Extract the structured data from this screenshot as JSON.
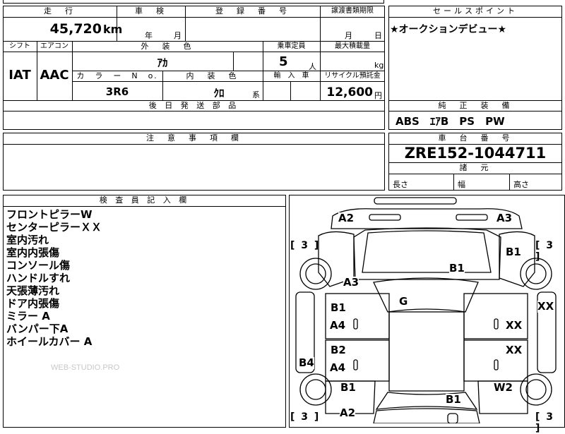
{
  "header_row": {
    "mileage": "走　行",
    "inspection": "車　検",
    "registration": "登　録　番　号",
    "transfer_deadline": "譲渡書類期限",
    "sales_point": "セールスポイント"
  },
  "values_row": {
    "mileage": "45,720",
    "mileage_unit": "km",
    "inspection_year": "年",
    "inspection_month": "月",
    "transfer_month": "月",
    "transfer_day": "日",
    "sales_point": "★オークションデビュー★"
  },
  "labels_row2": {
    "shift": "シフト",
    "aircon": "エアコン",
    "exterior_color": "外　装　色",
    "capacity": "乗車定員",
    "max_load": "最大積載量"
  },
  "values_row2": {
    "shift": "IAT",
    "aircon": "AAC",
    "exterior_color": "ｱｶ",
    "capacity": "5",
    "capacity_unit": "人",
    "max_load_unit": "kg"
  },
  "labels_row3": {
    "color_no": "カ　ラ　ー　N　o.",
    "interior_color": "内　装　色",
    "import": "輸　入　車",
    "recycle": "リサイクル預託金"
  },
  "values_row3": {
    "color_no": "3R6",
    "interior_color": "ｸﾛ",
    "interior_suffix": "系",
    "recycle": "12,600",
    "recycle_unit": "円"
  },
  "parts_header": "後 日 発 送 部 品",
  "equipment": {
    "header": "純　正　装　備",
    "values": "ABS　ｴｱB　PS　PW"
  },
  "caution_header": "注　意　事　項　欄",
  "chassis": {
    "header": "車　台　番　号",
    "number": "ZRE152-1044711"
  },
  "dimensions": {
    "header": "諸　元",
    "length": "長さ",
    "width": "幅",
    "height": "高さ"
  },
  "inspector": {
    "header": "検 査 員 記 入 欄",
    "notes": [
      "フロントピラーW",
      "センターピラーＸＸ",
      "室内汚れ",
      "室内内張傷",
      "コンソール傷",
      "ハンドルすれ",
      "天張薄汚れ",
      "ドア内張傷",
      "ミラー A",
      "バンパー下A",
      "ホイールカバー A"
    ]
  },
  "watermark": "WEB-STUDIO.PRO",
  "diagram": {
    "marks": {
      "front_left": "A2",
      "front_right": "A3",
      "fender_right": "B1",
      "hood": "B1",
      "windshield_left": "A3",
      "roof": "G",
      "front_door_left_1": "B1",
      "front_door_left_2": "A4",
      "rear_door_left_1": "B2",
      "rear_door_left_2": "A4",
      "right_side": "XX",
      "front_door_right": "XX",
      "rear_door_right": "XX",
      "rocker_left": "B4",
      "rear_fender_left": "B1",
      "trunk": "B1",
      "rear_fender_right": "W2",
      "rear_left": "A2"
    },
    "tires": {
      "front_left": "[ 3 ]",
      "front_right": "[ 3 ]",
      "rear_left": "[ 3 ]",
      "rear_right": "[ 3 ]"
    }
  }
}
